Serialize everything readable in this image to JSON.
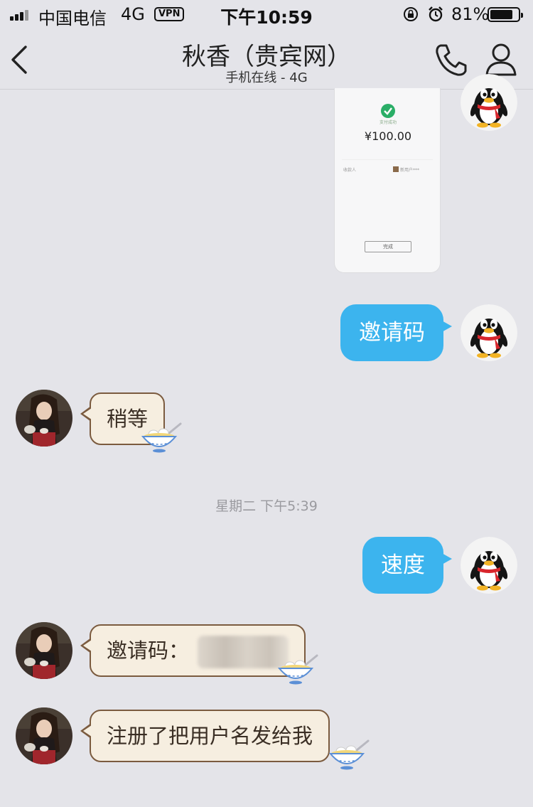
{
  "status_bar": {
    "carrier": "中国电信",
    "network": "4G",
    "vpn": "VPN",
    "time": "下午10:59",
    "battery_percent": "81%",
    "battery_level": 0.81
  },
  "nav": {
    "title": "秋香（贵宾网）",
    "subtitle": "手机在线 - 4G"
  },
  "payment_card": {
    "status_label": "支付成功",
    "amount": "¥100.00",
    "payee_label": "收款人",
    "merchant": "新用户***",
    "done_label": "完成"
  },
  "messages": [
    {
      "from": "me",
      "text": "邀请码"
    },
    {
      "from": "contact",
      "text": "稍等"
    },
    {
      "from": "me",
      "text": "速度"
    },
    {
      "from": "contact",
      "text": "邀请码："
    },
    {
      "from": "contact",
      "text": "注册了把用户名发给我"
    }
  ],
  "timestamp": "星期二 下午5:39",
  "colors": {
    "background": "#e4e4e9",
    "outgoing_bubble": "#3cb4ee",
    "incoming_bubble": "#f6eee0",
    "incoming_border": "#7b5b3f"
  },
  "icons": [
    "back-arrow-icon",
    "phone-icon",
    "profile-icon",
    "lock-rotation-icon",
    "alarm-icon",
    "qq-penguin-avatar",
    "rice-bowl-sticker-icon"
  ]
}
